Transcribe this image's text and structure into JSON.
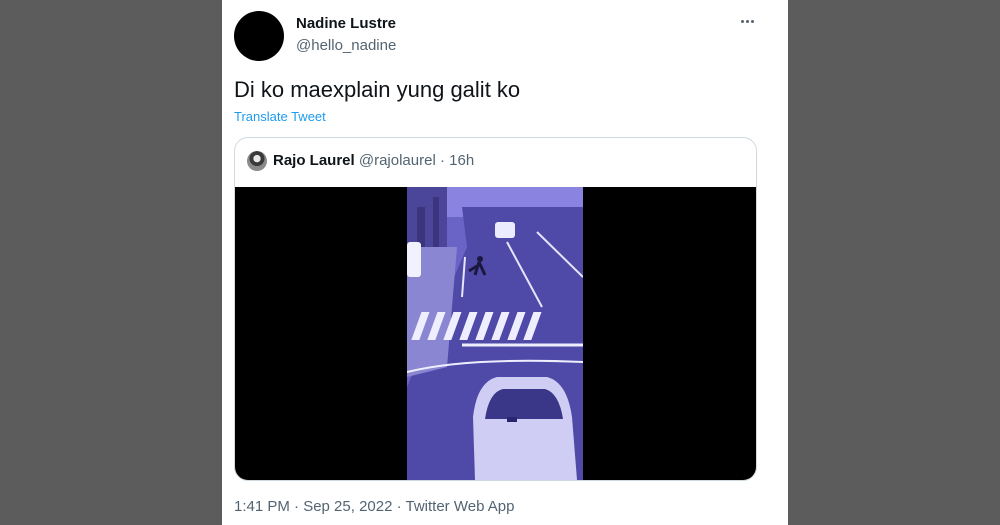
{
  "tweet": {
    "author_name": "Nadine Lustre",
    "author_handle": "@hello_nadine",
    "text": "Di ko maexplain yung galit ko",
    "translate_label": "Translate Tweet",
    "more_icon": "more-icon",
    "timestamp": "1:41 PM · Sep 25, 2022 · Twitter Web App"
  },
  "quoted": {
    "author_name": "Rajo Laurel",
    "author_handle": "@rajolaurel",
    "separator": "·",
    "time_ago": "16h",
    "media_type": "video"
  },
  "colors": {
    "background": "#5c5c5c",
    "card": "#ffffff",
    "link": "#1d9bf0",
    "secondary_text": "#536471",
    "video_tint": "#6a64c6"
  }
}
